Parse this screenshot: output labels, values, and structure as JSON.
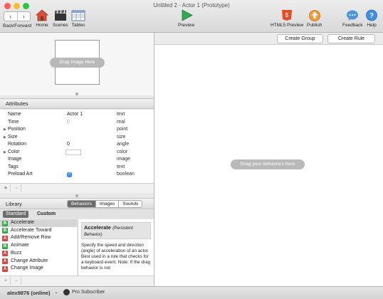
{
  "window": {
    "title": "Untitled 2 - Actor 1 (Prototype)"
  },
  "toolbar": {
    "back_forward_label": "Back/Forward",
    "home_label": "Home",
    "scenes_label": "Scenes",
    "tables_label": "Tables",
    "preview_label": "Preview",
    "html5_label": "HTML5 Preview",
    "publish_label": "Publish",
    "feedback_label": "Feedback",
    "help_label": "Help"
  },
  "image_well": {
    "drag_label": "Drag Image Here"
  },
  "attributes": {
    "header": "Attributes",
    "rows": [
      {
        "name": "Name",
        "value": "Actor 1",
        "type": "text",
        "expandable": false
      },
      {
        "name": "Time",
        "value": "0",
        "type": "real",
        "expandable": false
      },
      {
        "name": "Position",
        "value": "",
        "type": "point",
        "expandable": true
      },
      {
        "name": "Size",
        "value": "",
        "type": "size",
        "expandable": true
      },
      {
        "name": "Rotation",
        "value": "0",
        "type": "angle",
        "expandable": false
      },
      {
        "name": "Color",
        "value": "",
        "type": "color",
        "expandable": true
      },
      {
        "name": "Image",
        "value": "",
        "type": "image",
        "expandable": false
      },
      {
        "name": "Tags",
        "value": "",
        "type": "text",
        "expandable": false
      },
      {
        "name": "Preload Art",
        "value": "",
        "type": "boolean",
        "expandable": false
      }
    ],
    "add_label": "+",
    "remove_label": "−"
  },
  "library": {
    "header": "Library",
    "tabs": [
      "Behaviors",
      "Images",
      "Sounds"
    ],
    "selected_tab": "Behaviors",
    "subtabs": [
      "Standard",
      "Custom"
    ],
    "selected_subtab": "Standard",
    "behaviors": [
      {
        "badge": "B",
        "label": "Accelerate",
        "color": "#3aa54a"
      },
      {
        "badge": "B",
        "label": "Accelerate Toward",
        "color": "#3aa54a"
      },
      {
        "badge": "A",
        "label": "Add/Remove Row",
        "color": "#d9463f"
      },
      {
        "badge": "B",
        "label": "Animate",
        "color": "#3aa54a"
      },
      {
        "badge": "A",
        "label": "Buzz",
        "color": "#d9463f"
      },
      {
        "badge": "A",
        "label": "Change Attribute",
        "color": "#d9463f"
      },
      {
        "badge": "A",
        "label": "Change Image",
        "color": "#d9463f"
      }
    ],
    "selected_index": 0,
    "description": {
      "title": "Accelerate",
      "subtitle": "(Persistent Behavior)",
      "text": "Specify the speed and direction (angle) of acceleration of an actor. Best used in a rule that checks for a keyboard event. Note: If the drag behavior is not"
    }
  },
  "rules_pane": {
    "create_group_label": "Create Group",
    "create_rule_label": "Create Rule",
    "drag_behaviors_label": "Drag your behaviors here"
  },
  "status": {
    "user": "alex9876 (online)",
    "subscription": "Pro Subscriber"
  }
}
